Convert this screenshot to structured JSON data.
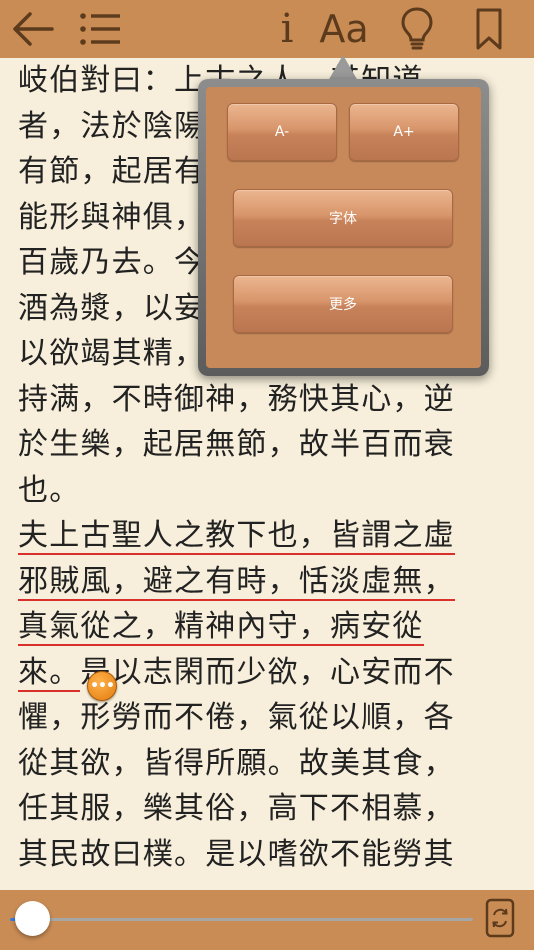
{
  "toolbar": {
    "info_label": "i",
    "font_label": "Aa"
  },
  "content": {
    "lines": [
      {
        "text": "岐伯對曰：上古之人，其知道",
        "highlight": false
      },
      {
        "text": "者，法於陰陽，和於術數，食",
        "highlight": false
      },
      {
        "text": "有節，起居有常，不妄作勞，",
        "highlight": false
      },
      {
        "text": "能形與神俱，而盡終其天年，",
        "highlight": false
      },
      {
        "text": "百歲乃去。今時之人不然也，",
        "highlight": false
      },
      {
        "text": "酒為漿，以妄為常，醉以入房，",
        "highlight": false
      },
      {
        "text": "以欲竭其精，以耗散其真，不知",
        "highlight": false
      },
      {
        "text": "持满，不時御神，務快其心，逆",
        "highlight": false
      },
      {
        "text": "於生樂，起居無節，故半百而衰",
        "highlight": false
      },
      {
        "text": "也。",
        "highlight": false
      },
      {
        "text": "夫上古聖人之教下也，皆謂之虛",
        "highlight": true
      },
      {
        "text": "邪賊風，避之有時，恬淡虛無，",
        "highlight": true
      },
      {
        "text": "真氣從之，精神內守，病安從",
        "highlight": true
      },
      {
        "hl": "來。",
        "rest": "是以志閑而少欲，心安而不",
        "highlight": "partial"
      },
      {
        "text": "懼，形勞而不倦，氣從以順，各",
        "highlight": false
      },
      {
        "text": "從其欲，皆得所願。故美其食，",
        "highlight": false
      },
      {
        "text": "任其服，樂其俗，高下不相慕，",
        "highlight": false
      },
      {
        "text": "其民故曰樸。是以嗜欲不能勞其",
        "highlight": false
      }
    ]
  },
  "note_marker": {
    "label": "•••"
  },
  "popover": {
    "font_decrease_label": "A-",
    "font_increase_label": "A+",
    "font_face_label": "字体",
    "more_label": "更多"
  },
  "progress": {
    "fraction": 0.04
  },
  "colors": {
    "bar": "#c98c55",
    "paper": "#f7efdb",
    "icon": "#5c3a1c",
    "highlight": "#d9302b"
  }
}
